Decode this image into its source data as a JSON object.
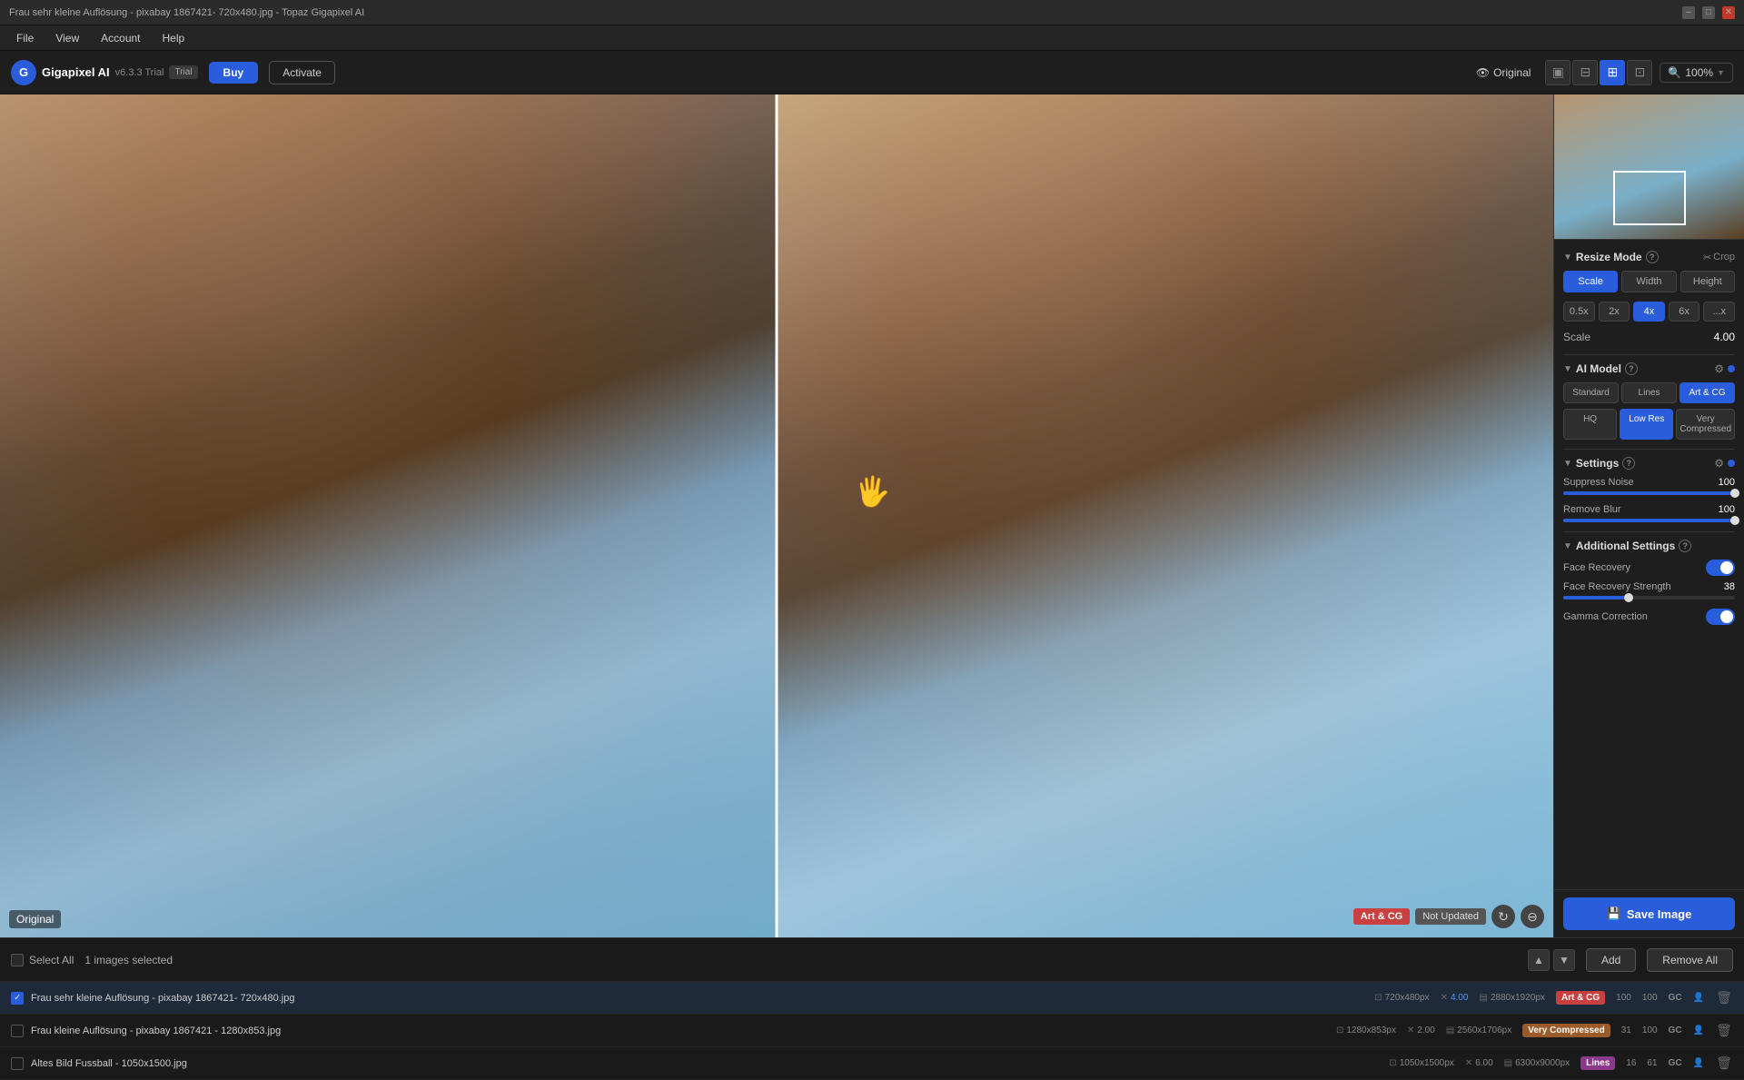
{
  "titlebar": {
    "title": "Frau sehr kleine Auflösung - pixabay 1867421- 720x480.jpg - Topaz Gigapixel AI",
    "minimize": "–",
    "maximize": "□",
    "close": "✕"
  },
  "menubar": {
    "items": [
      "File",
      "View",
      "Account",
      "Help"
    ]
  },
  "toolbar": {
    "logo_letter": "G",
    "app_name": "Gigapixel AI",
    "version": "v6.3.3 Trial",
    "trial_label": "Trial",
    "buy_label": "Buy",
    "activate_label": "Activate",
    "original_label": "Original",
    "zoom_label": "100%"
  },
  "right_panel": {
    "resize_mode_label": "Resize Mode",
    "crop_label": "Crop",
    "scale_tabs": [
      "Scale",
      "Width",
      "Height"
    ],
    "scale_active": "Scale",
    "scale_values": [
      "0.5x",
      "2x",
      "4x",
      "6x",
      "...x"
    ],
    "scale_active_val": "4x",
    "scale_label": "Scale",
    "scale_number": "4.00",
    "ai_model_label": "AI Model",
    "models": [
      "Standard",
      "Lines",
      "Art & CG"
    ],
    "model_active": "Art & CG",
    "quality_btns": [
      "HQ",
      "Low Res",
      "Very Compressed"
    ],
    "quality_active": "Low Res",
    "settings_label": "Settings",
    "suppress_noise_label": "Suppress Noise",
    "suppress_noise_value": "100",
    "suppress_noise_pct": 100,
    "remove_blur_label": "Remove Blur",
    "remove_blur_value": "100",
    "remove_blur_pct": 100,
    "additional_settings_label": "Additional Settings",
    "face_recovery_label": "Face Recovery",
    "face_recovery_strength_label": "Face Recovery Strength",
    "face_recovery_strength_value": "38",
    "face_recovery_strength_pct": 38,
    "gamma_correction_label": "Gamma Correction",
    "save_label": "Save Image"
  },
  "canvas": {
    "original_label": "Original",
    "badge_art": "Art & CG",
    "badge_notupdated": "Not Updated"
  },
  "bottom_bar": {
    "select_all": "Select All",
    "images_selected": "1 images selected",
    "add_label": "Add",
    "remove_all_label": "Remove All"
  },
  "file_list": [
    {
      "name": "Frau sehr kleine Auflösung - pixabay 1867421- 720x480.jpg",
      "selected": true,
      "checked": true,
      "src_size": "720x480px",
      "scale": "4.00",
      "out_size": "2880x1920px",
      "model": "Art & CG",
      "model_type": "art",
      "noise": "100",
      "blur": "100",
      "gc": "GC"
    },
    {
      "name": "Frau kleine Auflösung - pixabay 1867421 - 1280x853.jpg",
      "selected": false,
      "checked": false,
      "src_size": "1280x853px",
      "scale": "2.00",
      "out_size": "2560x1706px",
      "model": "Very Compressed",
      "model_type": "verycompressed",
      "noise": "31",
      "blur": "100",
      "gc": "GC"
    },
    {
      "name": "Altes Bild Fussball - 1050x1500.jpg",
      "selected": false,
      "checked": false,
      "src_size": "1050x1500px",
      "scale": "6.00",
      "out_size": "6300x9000px",
      "model": "Lines",
      "model_type": "lines",
      "noise": "16",
      "blur": "61",
      "gc": "GC"
    }
  ]
}
